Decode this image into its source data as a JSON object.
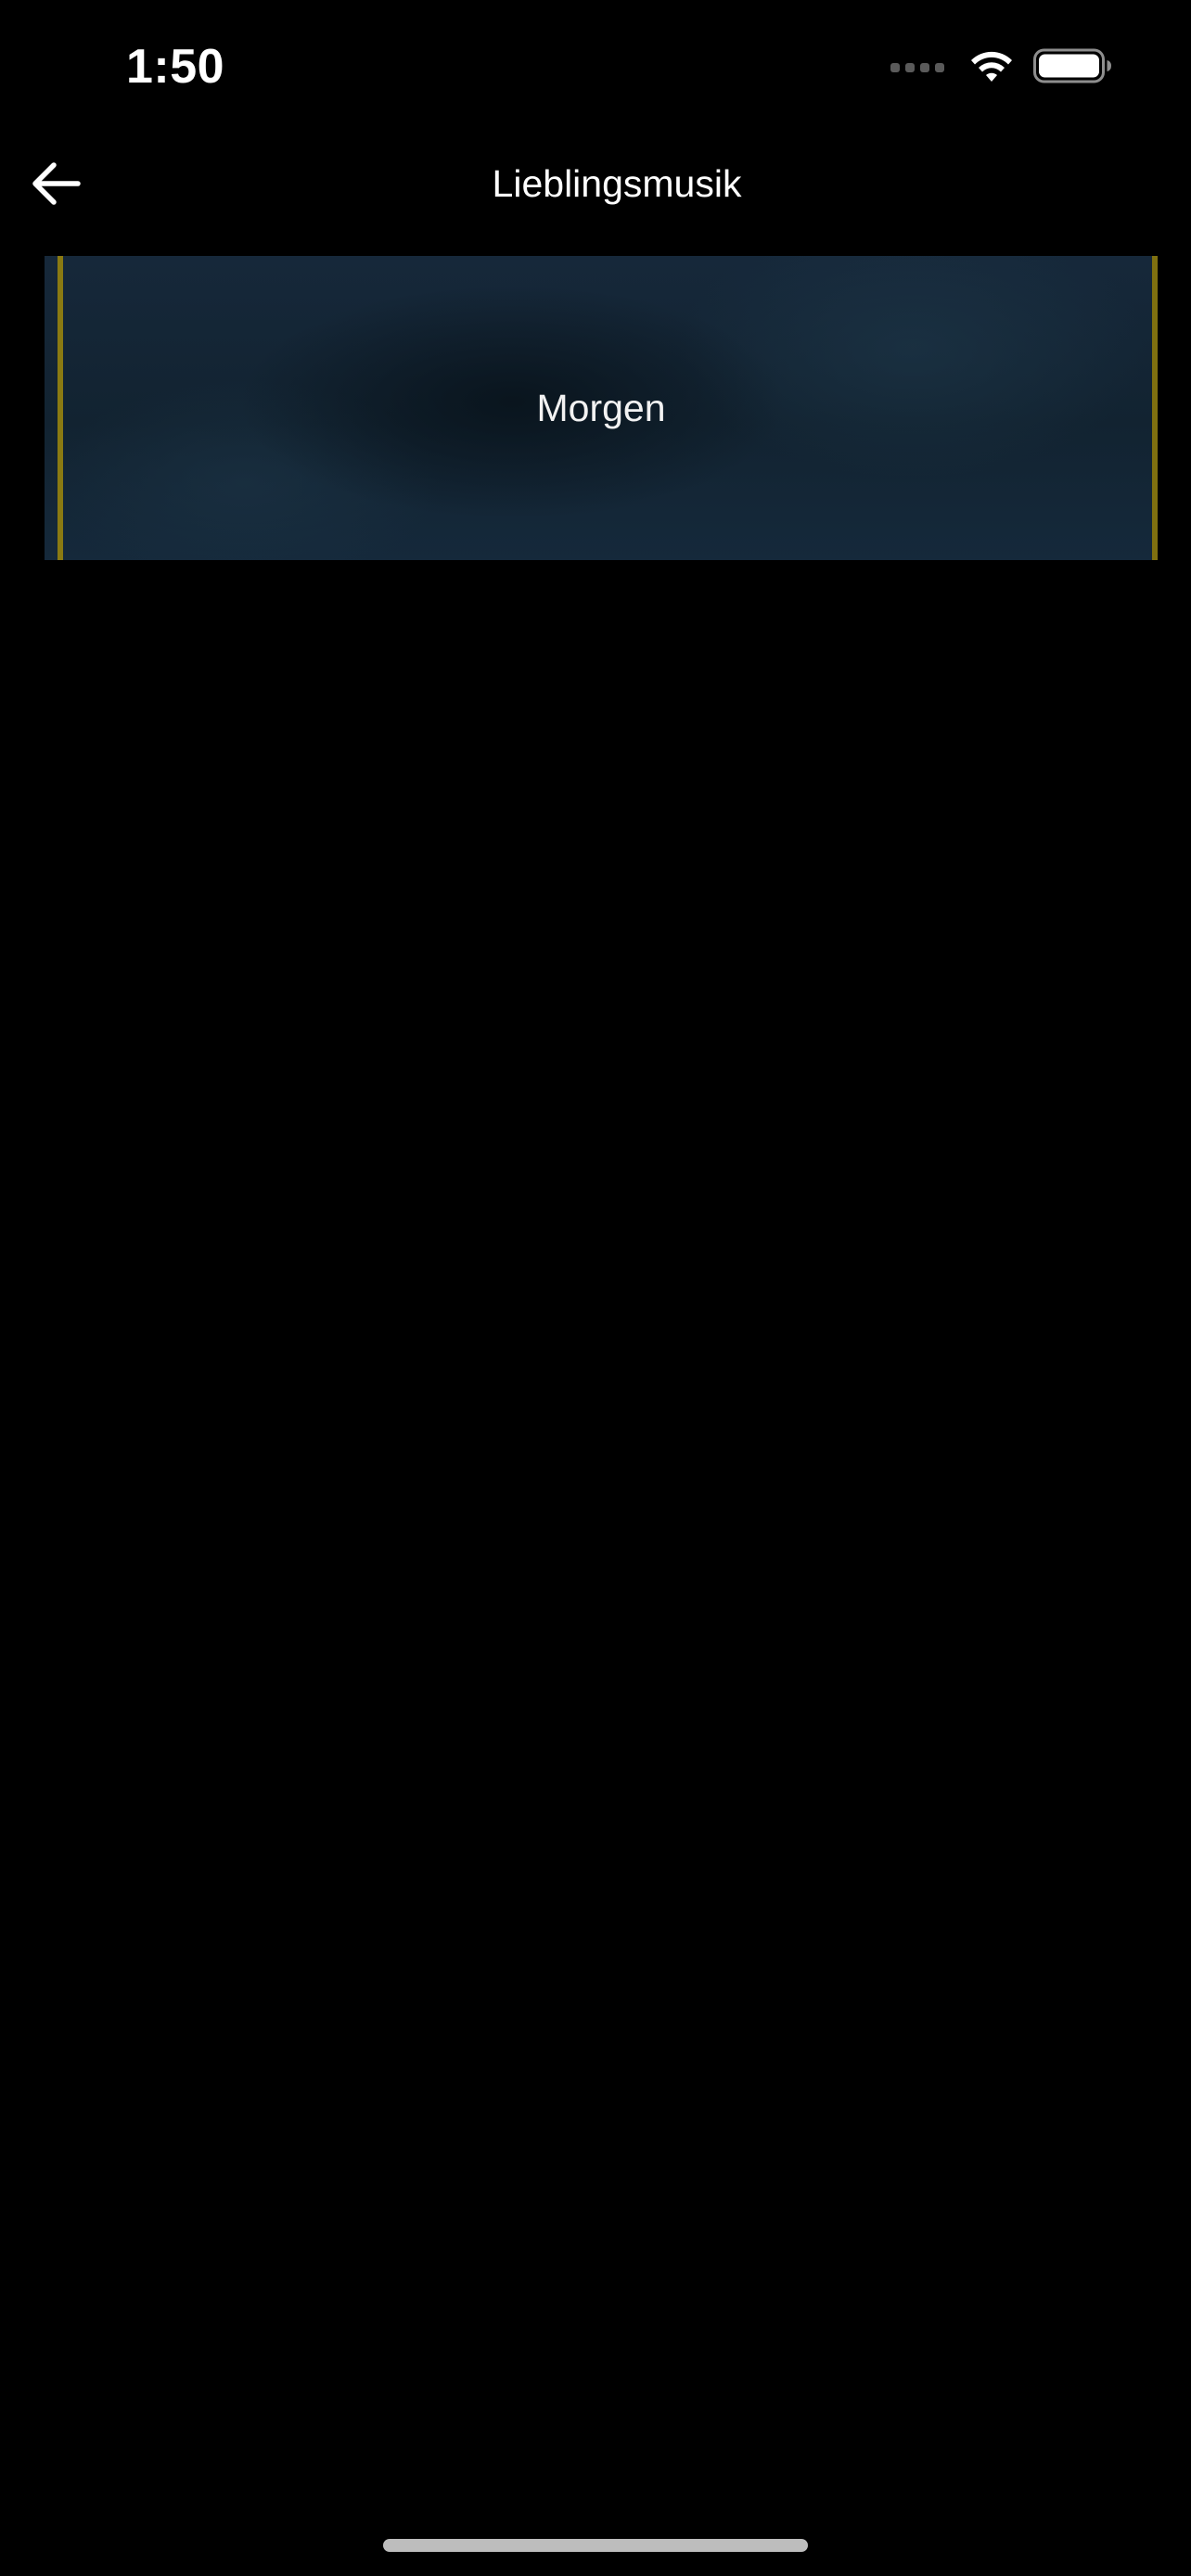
{
  "status_bar": {
    "time": "1:50",
    "icons": [
      "signal-dots-icon",
      "wifi-icon",
      "battery-icon"
    ]
  },
  "nav": {
    "back_icon": "arrow-left-icon",
    "title": "Lieblingsmusik"
  },
  "playlists": [
    {
      "label": "Morgen"
    }
  ],
  "colors": {
    "background": "#000000",
    "card_background": "#14263a",
    "card_accent": "#8a7a12",
    "text": "#ffffff"
  }
}
